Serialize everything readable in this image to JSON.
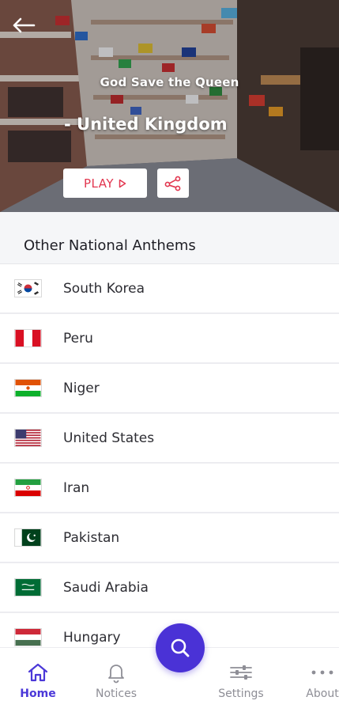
{
  "hero": {
    "anthem_title": "God Save the Queen",
    "country": "- United Kingdom",
    "play_label": "PLAY",
    "icons": {
      "back": "back-arrow-icon",
      "play": "play-triangle-icon",
      "share": "share-icon"
    }
  },
  "list": {
    "heading": "Other National Anthems",
    "items": [
      {
        "name": "South Korea",
        "flag": "south-korea-flag"
      },
      {
        "name": "Peru",
        "flag": "peru-flag"
      },
      {
        "name": "Niger",
        "flag": "niger-flag"
      },
      {
        "name": "United States",
        "flag": "united-states-flag"
      },
      {
        "name": "Iran",
        "flag": "iran-flag"
      },
      {
        "name": "Pakistan",
        "flag": "pakistan-flag"
      },
      {
        "name": "Saudi Arabia",
        "flag": "saudi-arabia-flag"
      },
      {
        "name": "Hungary",
        "flag": "hungary-flag"
      }
    ]
  },
  "bottom_nav": {
    "items": [
      {
        "label": "Home",
        "icon": "home-icon",
        "active": true
      },
      {
        "label": "Notices",
        "icon": "bell-icon",
        "active": false
      },
      {
        "label": "Settings",
        "icon": "sliders-icon",
        "active": false
      },
      {
        "label": "About",
        "icon": "more-dots-icon",
        "active": false
      }
    ],
    "fab_icon": "search-icon"
  },
  "colors": {
    "accent": "#4a32d6",
    "play_red": "#e2364f",
    "active_nav": "#4b38d8",
    "inactive_nav": "#8e8e96"
  }
}
